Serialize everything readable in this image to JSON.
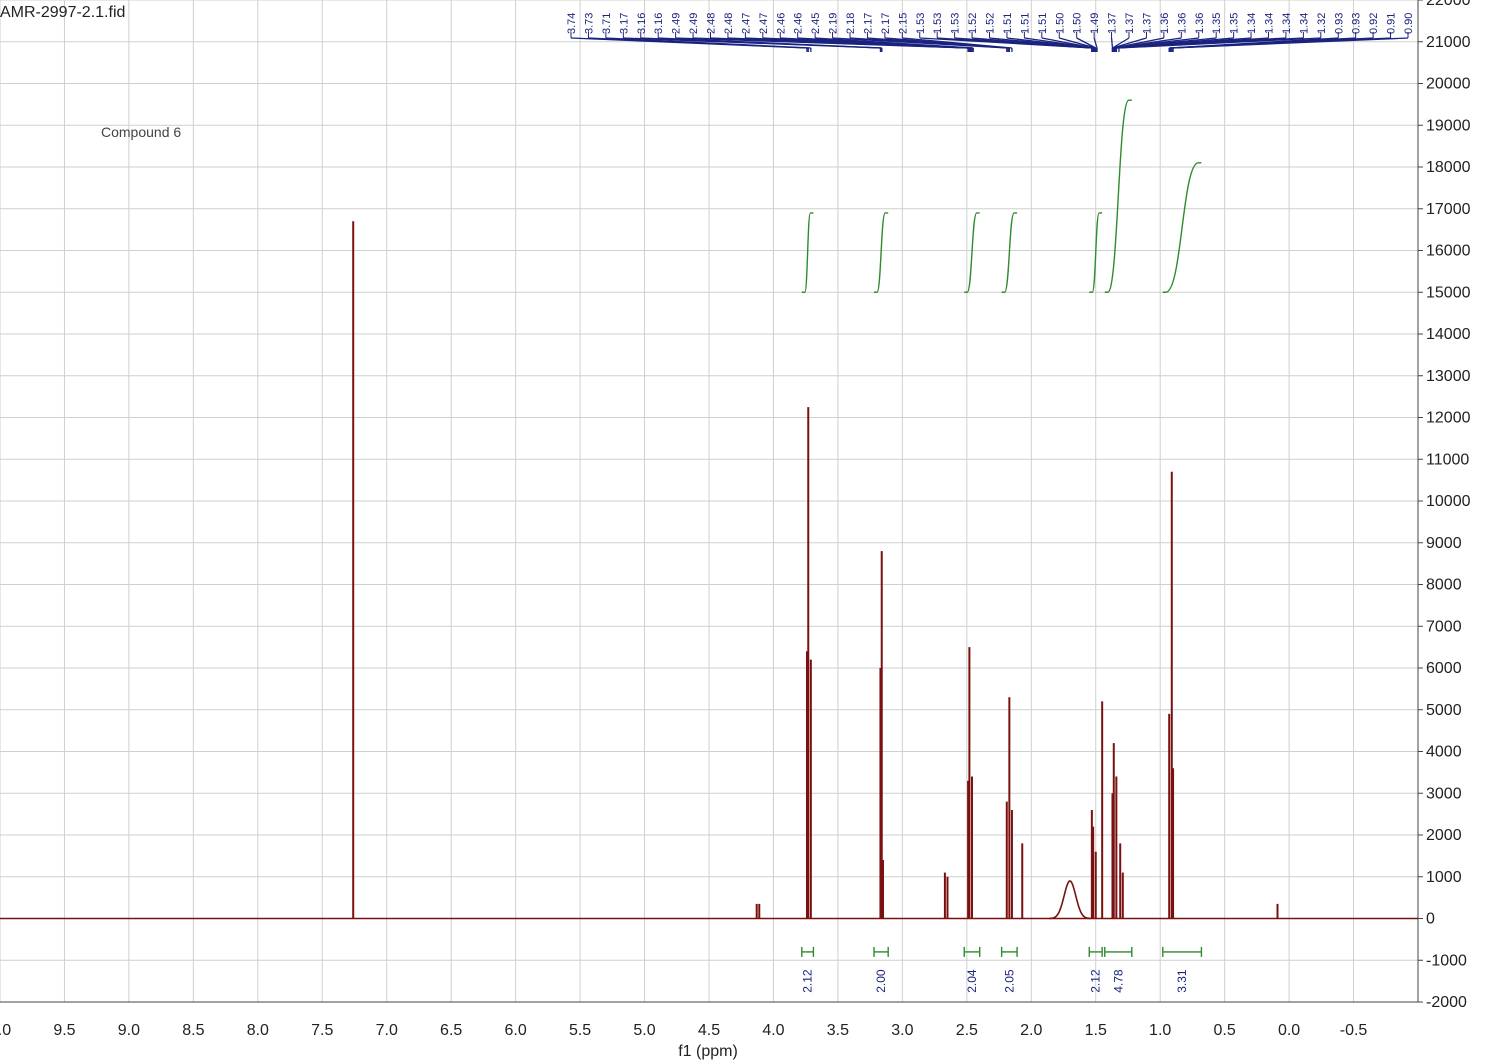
{
  "header": {
    "file_title": "AMR-2997-2.1.fid",
    "compound_label": "Compound 6"
  },
  "chart_data": {
    "type": "line",
    "title": "AMR-2997-2.1.fid",
    "xlabel": "f1 (ppm)",
    "ylabel": "",
    "xlim": [
      10.0,
      -1.0
    ],
    "ylim": [
      -2000,
      22000
    ],
    "x_ticks": [
      "0.0",
      "9.5",
      "9.0",
      "8.5",
      "8.0",
      "7.5",
      "7.0",
      "6.5",
      "6.0",
      "5.5",
      "5.0",
      "4.5",
      "4.0",
      "3.5",
      "3.0",
      "2.5",
      "2.0",
      "1.5",
      "1.0",
      "0.5",
      "0.0",
      "-0.5"
    ],
    "y_ticks": [
      "-2000",
      "-1000",
      "0",
      "1000",
      "2000",
      "3000",
      "4000",
      "5000",
      "6000",
      "7000",
      "8000",
      "9000",
      "10000",
      "11000",
      "12000",
      "13000",
      "14000",
      "15000",
      "16000",
      "17000",
      "18000",
      "19000",
      "20000",
      "21000",
      "22000"
    ],
    "grid": true,
    "peaks": [
      {
        "ppm": 7.26,
        "height": 16700
      },
      {
        "ppm": 3.74,
        "height": 6400
      },
      {
        "ppm": 3.73,
        "height": 12250
      },
      {
        "ppm": 3.71,
        "height": 6200
      },
      {
        "ppm": 3.17,
        "height": 6000
      },
      {
        "ppm": 3.16,
        "height": 8800
      },
      {
        "ppm": 3.15,
        "height": 1400
      },
      {
        "ppm": 2.67,
        "height": 1100
      },
      {
        "ppm": 2.65,
        "height": 1000
      },
      {
        "ppm": 2.49,
        "height": 3300
      },
      {
        "ppm": 2.48,
        "height": 6500
      },
      {
        "ppm": 2.46,
        "height": 3400
      },
      {
        "ppm": 2.19,
        "height": 2800
      },
      {
        "ppm": 2.17,
        "height": 5300
      },
      {
        "ppm": 2.15,
        "height": 2600
      },
      {
        "ppm": 2.07,
        "height": 1800
      },
      {
        "ppm": 1.53,
        "height": 2600
      },
      {
        "ppm": 1.52,
        "height": 2200
      },
      {
        "ppm": 1.5,
        "height": 1600
      },
      {
        "ppm": 1.45,
        "height": 5200
      },
      {
        "ppm": 1.37,
        "height": 3000
      },
      {
        "ppm": 1.36,
        "height": 4200
      },
      {
        "ppm": 1.34,
        "height": 3400
      },
      {
        "ppm": 1.31,
        "height": 1800
      },
      {
        "ppm": 1.29,
        "height": 1100
      },
      {
        "ppm": 0.93,
        "height": 4900
      },
      {
        "ppm": 0.91,
        "height": 10700
      },
      {
        "ppm": 0.9,
        "height": 3600
      },
      {
        "ppm": 0.09,
        "height": 350
      },
      {
        "ppm": 4.13,
        "height": 350
      },
      {
        "ppm": 4.11,
        "height": 350
      }
    ],
    "broad_peaks": [
      {
        "ppm": 1.7,
        "height": 900
      }
    ],
    "peak_labels": [
      "3.74",
      "3.73",
      "3.71",
      "3.17",
      "3.16",
      "3.16",
      "2.49",
      "2.49",
      "2.48",
      "2.48",
      "2.47",
      "2.47",
      "2.46",
      "2.46",
      "2.45",
      "2.19",
      "2.18",
      "2.17",
      "2.17",
      "2.15",
      "1.53",
      "1.53",
      "1.53",
      "1.52",
      "1.52",
      "1.51",
      "1.51",
      "1.51",
      "1.50",
      "1.50",
      "1.49",
      "1.37",
      "1.37",
      "1.37",
      "1.36",
      "1.36",
      "1.36",
      "1.35",
      "1.35",
      "1.34",
      "1.34",
      "1.34",
      "1.34",
      "1.32",
      "0.93",
      "0.93",
      "0.92",
      "0.91",
      "0.90"
    ],
    "integrals": [
      {
        "from": 3.78,
        "to": 3.69,
        "value": "2.12"
      },
      {
        "from": 3.22,
        "to": 3.11,
        "value": "2.00"
      },
      {
        "from": 2.52,
        "to": 2.4,
        "value": "2.04"
      },
      {
        "from": 2.23,
        "to": 2.11,
        "value": "2.05"
      },
      {
        "from": 1.55,
        "to": 1.45,
        "value": "2.12"
      },
      {
        "from": 1.43,
        "to": 1.22,
        "value": "4.78"
      },
      {
        "from": 0.98,
        "to": 0.68,
        "value": "3.31"
      }
    ]
  },
  "colors": {
    "spectrum": "#7b1010",
    "peak_labels": "#1a237e",
    "integrals": "#2e8b2e",
    "grid": "#cfcfcf"
  }
}
